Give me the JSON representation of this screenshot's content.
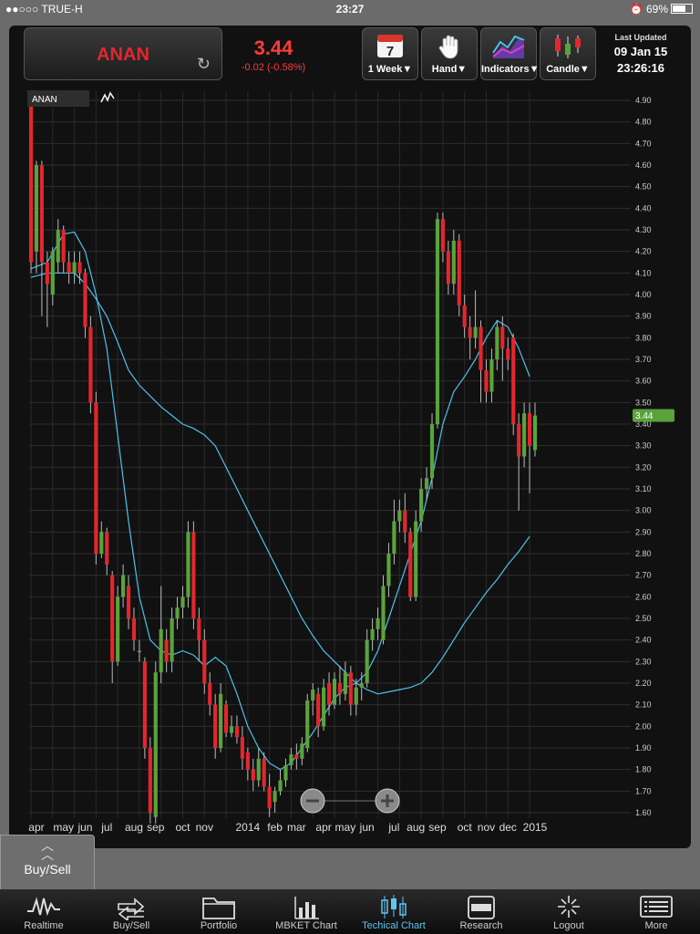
{
  "status": {
    "carrier": "●●○○○ TRUE-H",
    "time": "23:27",
    "battery": "69%"
  },
  "quote": {
    "symbol": "ANAN",
    "price": "3.44",
    "change": "-0.02 (-0.58%)"
  },
  "toolbar": {
    "period_label": "1 Week▼",
    "calendar_day": "7",
    "hand_label": "Hand▼",
    "indicators_label": "Indicators▼",
    "candle_label": "Candle▼"
  },
  "updated": {
    "title": "Last Updated",
    "date": "09 Jan 15",
    "time": "23:26:16"
  },
  "legend": {
    "symbol": "ANAN"
  },
  "chart_data": {
    "type": "candlestick",
    "ylim": [
      1.55,
      4.95
    ],
    "y_ticks": [
      "4.90",
      "4.80",
      "4.70",
      "4.60",
      "4.50",
      "4.40",
      "4.30",
      "4.20",
      "4.10",
      "4.00",
      "3.90",
      "3.80",
      "3.70",
      "3.60",
      "3.50",
      "3.40",
      "3.30",
      "3.20",
      "3.10",
      "3.00",
      "2.90",
      "2.80",
      "2.70",
      "2.60",
      "2.50",
      "2.40",
      "2.30",
      "2.20",
      "2.10",
      "2.00",
      "1.90",
      "1.80",
      "1.70",
      "1.60"
    ],
    "x_labels": [
      {
        "label": "apr",
        "i": 1
      },
      {
        "label": "may",
        "i": 6
      },
      {
        "label": "jun",
        "i": 10
      },
      {
        "label": "jul",
        "i": 14
      },
      {
        "label": "aug",
        "i": 19
      },
      {
        "label": "sep",
        "i": 23
      },
      {
        "label": "oct",
        "i": 28
      },
      {
        "label": "nov",
        "i": 32
      },
      {
        "label": "2014",
        "i": 40
      },
      {
        "label": "feb",
        "i": 45
      },
      {
        "label": "mar",
        "i": 49
      },
      {
        "label": "apr",
        "i": 54
      },
      {
        "label": "may",
        "i": 58
      },
      {
        "label": "jun",
        "i": 62
      },
      {
        "label": "jul",
        "i": 67
      },
      {
        "label": "aug",
        "i": 71
      },
      {
        "label": "sep",
        "i": 75
      },
      {
        "label": "oct",
        "i": 80
      },
      {
        "label": "nov",
        "i": 84
      },
      {
        "label": "dec",
        "i": 88
      },
      {
        "label": "2015",
        "i": 93
      }
    ],
    "last_price_label": "3.44",
    "candles": [
      [
        4.9,
        4.15,
        4.9,
        4.1
      ],
      [
        4.2,
        4.6,
        4.62,
        4.1
      ],
      [
        4.6,
        4.15,
        4.62,
        3.9
      ],
      [
        4.15,
        4.05,
        4.2,
        3.85
      ],
      [
        4.0,
        4.2,
        4.22,
        3.95
      ],
      [
        4.15,
        4.3,
        4.35,
        4.1
      ],
      [
        4.3,
        4.15,
        4.32,
        4.1
      ],
      [
        4.15,
        4.1,
        4.2,
        4.05
      ],
      [
        4.1,
        4.15,
        4.2,
        4.05
      ],
      [
        4.15,
        4.1,
        4.2,
        4.05
      ],
      [
        4.1,
        3.85,
        4.12,
        3.8
      ],
      [
        3.85,
        3.5,
        3.9,
        3.45
      ],
      [
        3.5,
        2.8,
        3.55,
        2.75
      ],
      [
        2.8,
        2.9,
        2.95,
        2.78
      ],
      [
        2.9,
        2.75,
        2.92,
        2.7
      ],
      [
        2.7,
        2.3,
        2.72,
        2.2
      ],
      [
        2.3,
        2.6,
        2.65,
        2.28
      ],
      [
        2.6,
        2.7,
        2.75,
        2.55
      ],
      [
        2.65,
        2.5,
        2.7,
        2.45
      ],
      [
        2.5,
        2.4,
        2.55,
        2.35
      ],
      [
        2.35,
        2.35,
        2.4,
        2.3
      ],
      [
        2.3,
        1.9,
        2.32,
        1.85
      ],
      [
        1.9,
        1.6,
        1.95,
        1.55
      ],
      [
        1.58,
        2.25,
        2.3,
        1.55
      ],
      [
        2.25,
        2.45,
        2.65,
        2.2
      ],
      [
        2.4,
        2.3,
        2.45,
        2.25
      ],
      [
        2.3,
        2.5,
        2.55,
        2.25
      ],
      [
        2.5,
        2.55,
        2.6,
        2.45
      ],
      [
        2.55,
        2.6,
        2.65,
        2.5
      ],
      [
        2.6,
        2.9,
        2.95,
        2.55
      ],
      [
        2.9,
        2.5,
        2.95,
        2.45
      ],
      [
        2.5,
        2.4,
        2.55,
        2.3
      ],
      [
        2.4,
        2.2,
        2.45,
        2.15
      ],
      [
        2.2,
        2.1,
        2.25,
        2.05
      ],
      [
        2.1,
        1.9,
        2.15,
        1.85
      ],
      [
        1.9,
        2.15,
        2.2,
        1.88
      ],
      [
        2.1,
        1.97,
        2.12,
        1.95
      ],
      [
        1.97,
        2.0,
        2.05,
        1.95
      ],
      [
        2.0,
        1.95,
        2.05,
        1.92
      ],
      [
        1.95,
        1.85,
        2.0,
        1.8
      ],
      [
        1.88,
        1.8,
        1.9,
        1.75
      ],
      [
        1.8,
        1.75,
        1.85,
        1.7
      ],
      [
        1.75,
        1.85,
        1.9,
        1.72
      ],
      [
        1.85,
        1.72,
        1.88,
        1.7
      ],
      [
        1.72,
        1.62,
        1.78,
        1.58
      ],
      [
        1.65,
        1.7,
        1.72,
        1.6
      ],
      [
        1.7,
        1.75,
        1.8,
        1.68
      ],
      [
        1.75,
        1.82,
        1.85,
        1.72
      ],
      [
        1.82,
        1.87,
        1.9,
        1.8
      ],
      [
        1.87,
        1.85,
        1.92,
        1.8
      ],
      [
        1.85,
        1.92,
        1.95,
        1.82
      ],
      [
        1.9,
        2.12,
        2.15,
        1.88
      ],
      [
        2.12,
        2.17,
        2.2,
        2.05
      ],
      [
        2.15,
        2.0,
        2.18,
        1.95
      ],
      [
        2.0,
        2.18,
        2.22,
        1.98
      ],
      [
        2.2,
        2.1,
        2.25,
        2.05
      ],
      [
        2.1,
        2.22,
        2.25,
        2.08
      ],
      [
        2.2,
        2.15,
        2.28,
        2.1
      ],
      [
        2.15,
        2.25,
        2.3,
        2.12
      ],
      [
        2.25,
        2.1,
        2.28,
        2.05
      ],
      [
        2.1,
        2.18,
        2.22,
        2.05
      ],
      [
        2.18,
        2.2,
        2.25,
        2.12
      ],
      [
        2.2,
        2.4,
        2.45,
        2.18
      ],
      [
        2.4,
        2.45,
        2.5,
        2.35
      ],
      [
        2.45,
        2.5,
        2.55,
        2.4
      ],
      [
        2.4,
        2.65,
        2.7,
        2.38
      ],
      [
        2.65,
        2.8,
        2.85,
        2.6
      ],
      [
        2.8,
        2.95,
        3.05,
        2.75
      ],
      [
        2.95,
        3.0,
        3.05,
        2.9
      ],
      [
        3.0,
        2.9,
        3.08,
        2.85
      ],
      [
        2.9,
        2.6,
        2.92,
        2.58
      ],
      [
        2.6,
        2.95,
        3.0,
        2.58
      ],
      [
        2.95,
        3.1,
        3.15,
        2.9
      ],
      [
        3.1,
        3.15,
        3.2,
        3.05
      ],
      [
        3.15,
        3.4,
        3.45,
        3.1
      ],
      [
        3.4,
        4.35,
        4.38,
        3.38
      ],
      [
        4.35,
        4.2,
        4.38,
        4.15
      ],
      [
        4.2,
        4.05,
        4.25,
        4.0
      ],
      [
        4.05,
        4.25,
        4.3,
        4.0
      ],
      [
        4.25,
        3.95,
        4.28,
        3.9
      ],
      [
        3.95,
        3.85,
        4.0,
        3.8
      ],
      [
        3.85,
        3.8,
        3.9,
        3.7
      ],
      [
        3.8,
        3.85,
        4.02,
        3.75
      ],
      [
        3.85,
        3.65,
        3.88,
        3.5
      ],
      [
        3.65,
        3.55,
        3.7,
        3.5
      ],
      [
        3.55,
        3.7,
        3.75,
        3.5
      ],
      [
        3.7,
        3.85,
        3.88,
        3.65
      ],
      [
        3.85,
        3.75,
        3.9,
        3.6
      ],
      [
        3.75,
        3.7,
        3.8,
        3.65
      ],
      [
        3.8,
        3.4,
        3.82,
        3.35
      ],
      [
        3.4,
        3.25,
        3.45,
        3.0
      ],
      [
        3.25,
        3.45,
        3.5,
        3.2
      ],
      [
        3.45,
        3.3,
        3.5,
        3.08
      ],
      [
        3.28,
        3.44,
        3.5,
        3.25
      ]
    ],
    "ma_short": [
      [
        0,
        4.12
      ],
      [
        3,
        4.15
      ],
      [
        6,
        4.28
      ],
      [
        8,
        4.29
      ],
      [
        10,
        4.2
      ],
      [
        12,
        4.0
      ],
      [
        14,
        3.75
      ],
      [
        16,
        3.35
      ],
      [
        18,
        2.95
      ],
      [
        20,
        2.6
      ],
      [
        22,
        2.4
      ],
      [
        24,
        2.35
      ],
      [
        26,
        2.33
      ],
      [
        28,
        2.35
      ],
      [
        30,
        2.33
      ],
      [
        32,
        2.28
      ],
      [
        34,
        2.32
      ],
      [
        36,
        2.28
      ],
      [
        38,
        2.15
      ],
      [
        40,
        2.0
      ],
      [
        42,
        1.9
      ],
      [
        44,
        1.83
      ],
      [
        46,
        1.8
      ],
      [
        48,
        1.83
      ],
      [
        50,
        1.9
      ],
      [
        52,
        1.97
      ],
      [
        54,
        2.05
      ],
      [
        56,
        2.13
      ],
      [
        58,
        2.18
      ],
      [
        60,
        2.2
      ],
      [
        62,
        2.25
      ],
      [
        64,
        2.35
      ],
      [
        66,
        2.5
      ],
      [
        68,
        2.65
      ],
      [
        70,
        2.8
      ],
      [
        72,
        2.95
      ],
      [
        74,
        3.15
      ],
      [
        76,
        3.4
      ],
      [
        78,
        3.55
      ],
      [
        80,
        3.62
      ],
      [
        82,
        3.7
      ],
      [
        84,
        3.8
      ],
      [
        86,
        3.88
      ],
      [
        88,
        3.85
      ],
      [
        90,
        3.75
      ],
      [
        92,
        3.62
      ]
    ],
    "ma_long": [
      [
        0,
        4.08
      ],
      [
        3,
        4.1
      ],
      [
        6,
        4.1
      ],
      [
        8,
        4.1
      ],
      [
        10,
        4.05
      ],
      [
        12,
        3.98
      ],
      [
        14,
        3.9
      ],
      [
        16,
        3.78
      ],
      [
        18,
        3.65
      ],
      [
        20,
        3.58
      ],
      [
        22,
        3.53
      ],
      [
        24,
        3.48
      ],
      [
        26,
        3.44
      ],
      [
        28,
        3.4
      ],
      [
        30,
        3.38
      ],
      [
        32,
        3.35
      ],
      [
        34,
        3.3
      ],
      [
        36,
        3.2
      ],
      [
        38,
        3.1
      ],
      [
        40,
        3.0
      ],
      [
        42,
        2.9
      ],
      [
        44,
        2.8
      ],
      [
        46,
        2.7
      ],
      [
        48,
        2.6
      ],
      [
        50,
        2.5
      ],
      [
        52,
        2.42
      ],
      [
        54,
        2.35
      ],
      [
        56,
        2.3
      ],
      [
        58,
        2.25
      ],
      [
        60,
        2.2
      ],
      [
        62,
        2.17
      ],
      [
        64,
        2.15
      ],
      [
        66,
        2.16
      ],
      [
        68,
        2.17
      ],
      [
        70,
        2.18
      ],
      [
        72,
        2.2
      ],
      [
        74,
        2.25
      ],
      [
        76,
        2.32
      ],
      [
        78,
        2.4
      ],
      [
        80,
        2.48
      ],
      [
        82,
        2.55
      ],
      [
        84,
        2.62
      ],
      [
        86,
        2.68
      ],
      [
        88,
        2.75
      ],
      [
        90,
        2.81
      ],
      [
        92,
        2.88
      ]
    ]
  },
  "buysell": {
    "label": "Buy/Sell"
  },
  "tabs": [
    {
      "label": "Realtime"
    },
    {
      "label": "Buy/Sell"
    },
    {
      "label": "Portfolio"
    },
    {
      "label": "MBKET Chart"
    },
    {
      "label": "Techical Chart"
    },
    {
      "label": "Research"
    },
    {
      "label": "Logout"
    },
    {
      "label": "More"
    }
  ],
  "colors": {
    "up": "#5aa33c",
    "down": "#e3262e",
    "ma": "#4fc1e9",
    "accent": "#5ec6f0"
  }
}
